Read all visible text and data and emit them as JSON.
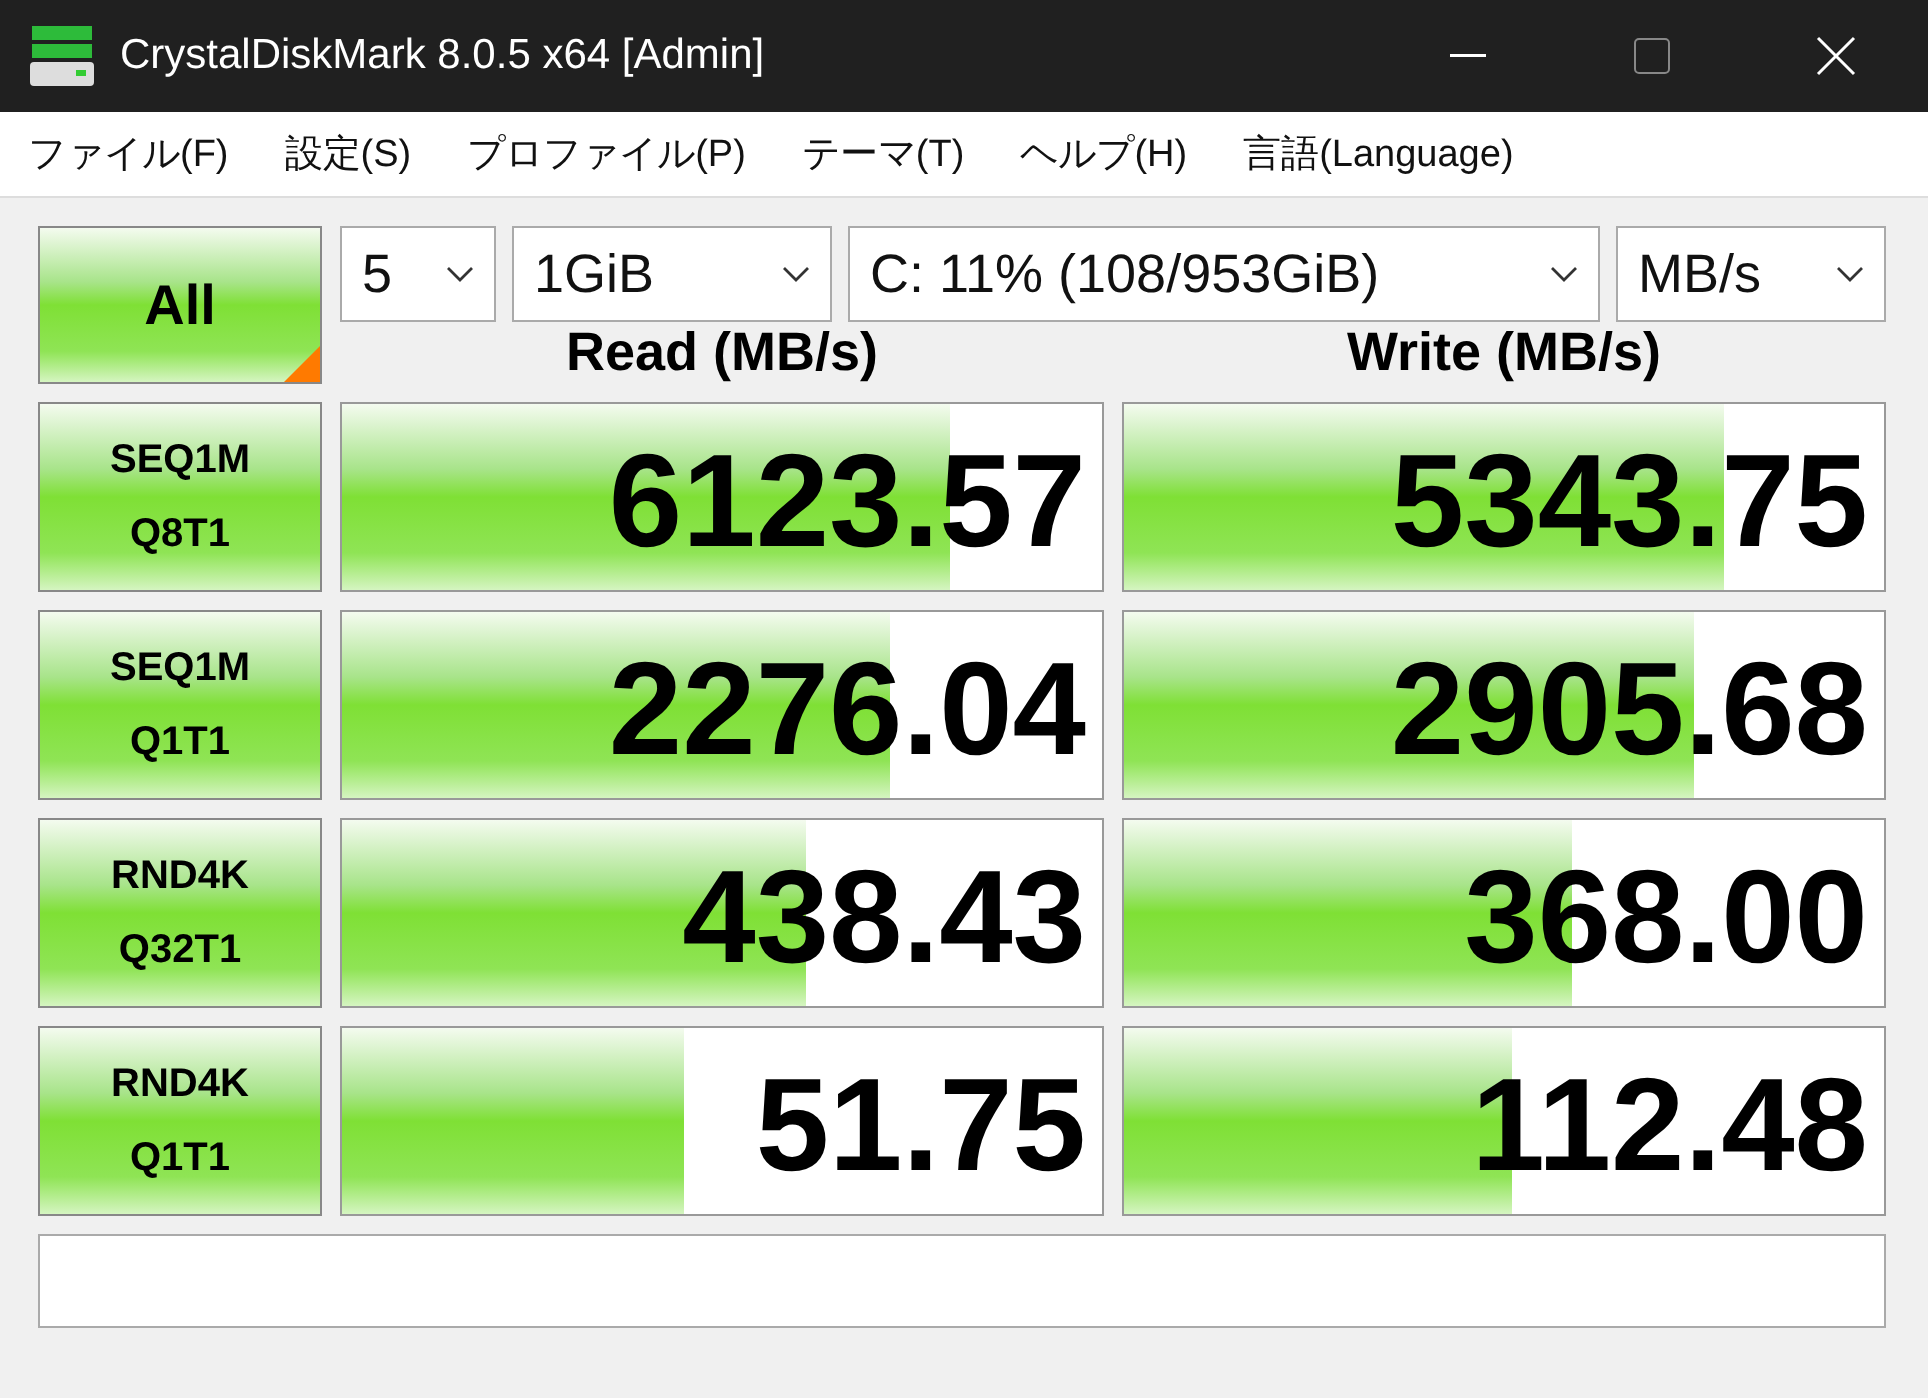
{
  "window": {
    "title": "CrystalDiskMark 8.0.5 x64 [Admin]"
  },
  "menu": [
    "ファイル(F)",
    "設定(S)",
    "プロファイル(P)",
    "テーマ(T)",
    "ヘルプ(H)",
    "言語(Language)"
  ],
  "all_button": {
    "label": "All"
  },
  "selectors": [
    {
      "value": "5"
    },
    {
      "value": "1GiB"
    },
    {
      "value": "C: 11% (108/953GiB)"
    },
    {
      "value": "MB/s"
    }
  ],
  "headers": {
    "read": "Read (MB/s)",
    "write": "Write (MB/s)"
  },
  "tests": [
    {
      "line1": "SEQ1M",
      "line2": "Q8T1",
      "read": {
        "value": "6123.57",
        "level": 0.8
      },
      "write": {
        "value": "5343.75",
        "level": 0.79
      }
    },
    {
      "line1": "SEQ1M",
      "line2": "Q1T1",
      "read": {
        "value": "2276.04",
        "level": 0.72
      },
      "write": {
        "value": "2905.68",
        "level": 0.75
      }
    },
    {
      "line1": "RND4K",
      "line2": "Q32T1",
      "read": {
        "value": "438.43",
        "level": 0.61
      },
      "write": {
        "value": "368.00",
        "level": 0.59
      }
    },
    {
      "line1": "RND4K",
      "line2": "Q1T1",
      "read": {
        "value": "51.75",
        "level": 0.45
      },
      "write": {
        "value": "112.48",
        "level": 0.51
      }
    }
  ]
}
